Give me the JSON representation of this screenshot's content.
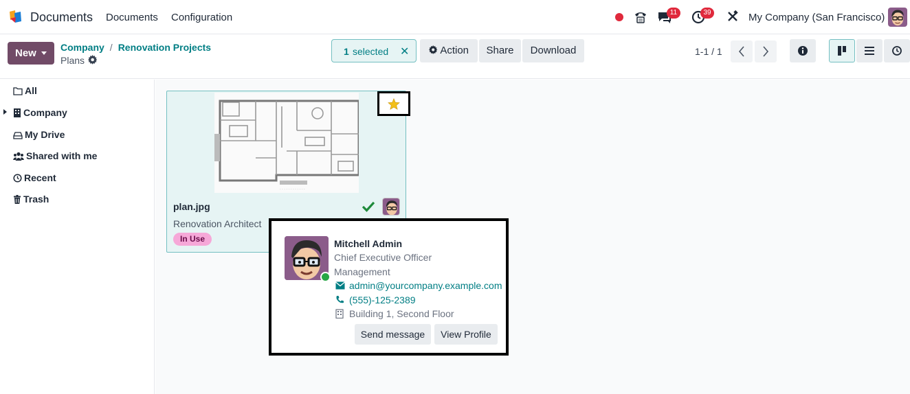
{
  "navbar": {
    "app_name": "Documents",
    "menu": [
      "Documents",
      "Configuration"
    ],
    "chat_badge": "11",
    "activity_badge": "39",
    "company": "My Company (San Francisco)"
  },
  "control": {
    "new_label": "New",
    "breadcrumb": [
      "Company",
      "Renovation Projects"
    ],
    "breadcrumb_sep": "/",
    "current": "Plans",
    "selected_count": "1",
    "selected_label": "selected",
    "action_label": "Action",
    "share_label": "Share",
    "download_label": "Download",
    "pager": "1-1 / 1"
  },
  "sidebar": {
    "items": [
      "All",
      "Company",
      "My Drive",
      "Shared with me",
      "Recent",
      "Trash"
    ]
  },
  "card": {
    "filename": "plan.jpg",
    "owner": "Renovation Architect",
    "tag": "In Use",
    "tag_color": "#f6a8d8"
  },
  "popover": {
    "name": "Mitchell Admin",
    "job_title": "Chief Executive Officer",
    "department": "Management",
    "email": "admin@yourcompany.example.com",
    "phone": "(555)-125-2389",
    "location": "Building 1, Second Floor",
    "send_message_label": "Send message",
    "view_profile_label": "View Profile"
  },
  "colors": {
    "brand": "#714b67",
    "accent": "#017e84",
    "badge": "#e0293c",
    "star": "#f3c019",
    "online": "#28a745"
  }
}
